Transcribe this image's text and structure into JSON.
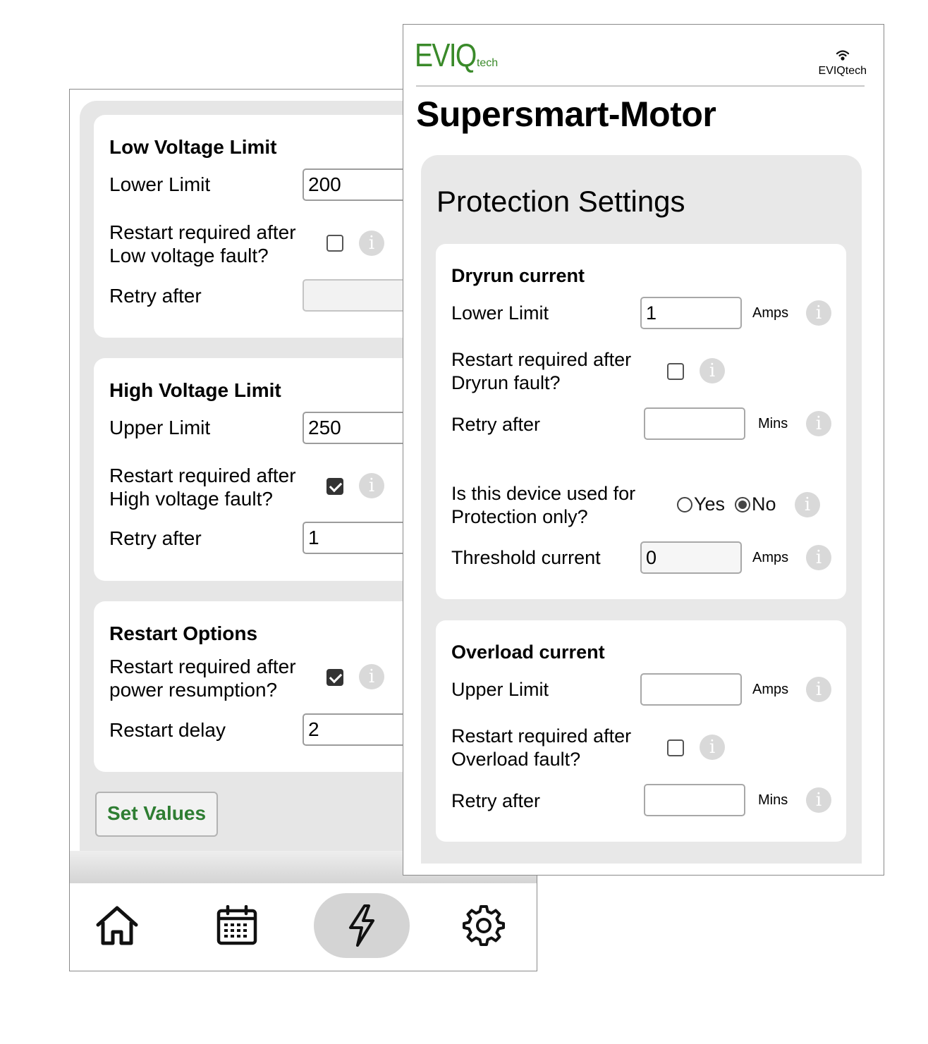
{
  "voltage_screen": {
    "low_voltage": {
      "title": "Low Voltage Limit",
      "lower_limit_label": "Lower Limit",
      "lower_limit_value": "200",
      "restart_label_1": "Restart required after",
      "restart_label_2": "Low voltage fault?",
      "restart_checked": false,
      "retry_label": "Retry after",
      "retry_value": ""
    },
    "high_voltage": {
      "title": "High Voltage Limit",
      "upper_limit_label": "Upper Limit",
      "upper_limit_value": "250",
      "restart_label_1": "Restart required after",
      "restart_label_2": "High voltage fault?",
      "restart_checked": true,
      "retry_label": "Retry after",
      "retry_value": "1"
    },
    "restart_options": {
      "title": "Restart Options",
      "restart_label_1": "Restart required after",
      "restart_label_2": "power resumption?",
      "restart_checked": true,
      "delay_label": "Restart delay",
      "delay_value": "2"
    },
    "set_values_label": "Set Values",
    "bottom_nav": {
      "items": [
        {
          "icon": "home-icon",
          "active": false
        },
        {
          "icon": "calendar-icon",
          "active": false
        },
        {
          "icon": "lightning-icon",
          "active": true
        },
        {
          "icon": "gear-icon",
          "active": false
        }
      ]
    }
  },
  "protection_screen": {
    "logo": {
      "main": "EVIQ",
      "sub": "tech"
    },
    "wifi_label": "EVIQtech",
    "device_name": "Supersmart-Motor",
    "section_title": "Protection Settings",
    "dryrun": {
      "title": "Dryrun current",
      "lower_limit_label": "Lower Limit",
      "lower_limit_value": "1",
      "lower_limit_unit": "Amps",
      "restart_label_1": "Restart required after",
      "restart_label_2": "Dryrun fault?",
      "restart_checked": false,
      "retry_label": "Retry after",
      "retry_value": "",
      "retry_unit": "Mins",
      "protection_label_1": "Is this device used for",
      "protection_label_2": "Protection only?",
      "protection_options": [
        "Yes",
        "No"
      ],
      "protection_selected": "No",
      "threshold_label": "Threshold current",
      "threshold_value": "0",
      "threshold_unit": "Amps"
    },
    "overload": {
      "title": "Overload current",
      "upper_limit_label": "Upper Limit",
      "upper_limit_value": "",
      "upper_limit_unit": "Amps",
      "restart_label_1": "Restart required after",
      "restart_label_2": "Overload fault?",
      "restart_checked": false,
      "retry_label": "Retry after",
      "retry_value": "",
      "retry_unit": "Mins"
    },
    "info_glyph": "i",
    "colors": {
      "brand_green": "#3a8a2a",
      "button_green": "#2e7d32",
      "panel_gray": "#e8e8e8"
    }
  }
}
